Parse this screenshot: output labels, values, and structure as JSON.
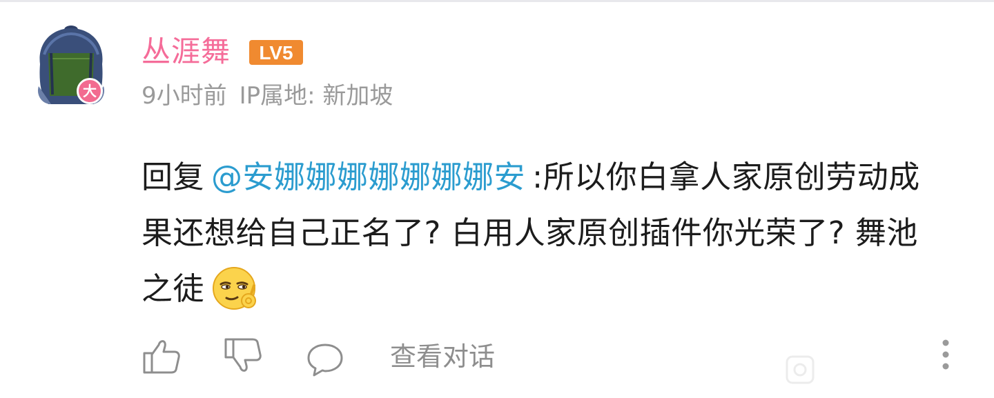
{
  "comment": {
    "author": {
      "name": "丛涯舞",
      "level": "LV5",
      "avatar_badge": "大"
    },
    "meta": {
      "time": "9小时前",
      "ip_location": "IP属地: 新加坡"
    },
    "reply_prefix": "回复",
    "mention": "@安娜娜娜娜娜娜娜安",
    "text": ":所以你白拿人家原创劳动成果还想给自己正名了? 白用人家原创插件你光荣了? 舞池之徒",
    "emoji_icon": "smug-ok-hand-emoji"
  },
  "actions": {
    "like_icon": "thumbs-up-icon",
    "dislike_icon": "thumbs-down-icon",
    "reply_icon": "speech-bubble-icon",
    "view_conversation": "查看对话",
    "more_icon": "vertical-ellipsis-icon"
  },
  "colors": {
    "username": "#f56c99",
    "level_badge": "#f08a30",
    "mention": "#2b9ccf",
    "meta_text": "#9a9a9a",
    "body_text": "#1c1c1c"
  }
}
